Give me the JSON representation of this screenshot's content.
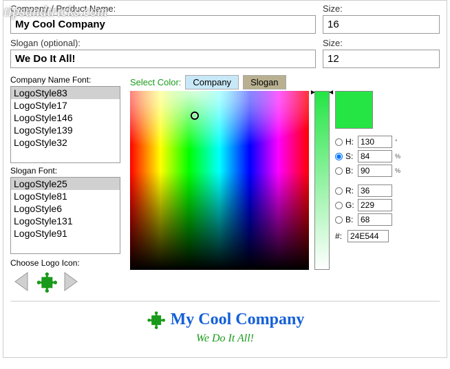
{
  "watermark": "tipsandtricks.com",
  "labels": {
    "company_name": "Company / Product Name:",
    "slogan": "Slogan (optional):",
    "size": "Size:",
    "company_font": "Company Name Font:",
    "slogan_font": "Slogan Font:",
    "select_color": "Select Color:",
    "tab_company": "Company",
    "tab_slogan": "Slogan",
    "choose_icon": "Choose Logo Icon:"
  },
  "inputs": {
    "company_name": "My Cool Company",
    "slogan": "We Do It All!",
    "size1": "16",
    "size2": "12"
  },
  "company_fonts": [
    "LogoStyle83",
    "LogoStyle17",
    "LogoStyle146",
    "LogoStyle139",
    "LogoStyle32"
  ],
  "company_font_selected": "LogoStyle83",
  "slogan_fonts": [
    "LogoStyle25",
    "LogoStyle81",
    "LogoStyle6",
    "LogoStyle131",
    "LogoStyle91"
  ],
  "slogan_font_selected": "LogoStyle25",
  "color_values": {
    "H": "130",
    "S": "84",
    "B": "90",
    "R": "36",
    "G": "229",
    "Bb": "68",
    "hex": "24E544",
    "swatch": "#24E544",
    "selected_mode": "S"
  },
  "hsv_labels": {
    "H": "H:",
    "S": "S:",
    "B": "B:",
    "R": "R:",
    "G": "G:",
    "Bb": "B:",
    "hash": "#:"
  },
  "units": {
    "H": "°",
    "S": "%",
    "B": "%"
  },
  "preview": {
    "company": "My Cool Company",
    "slogan": "We Do It All!"
  }
}
